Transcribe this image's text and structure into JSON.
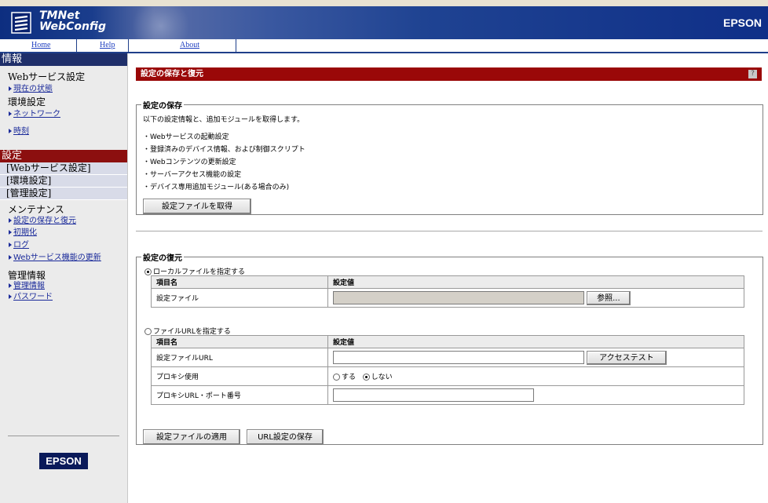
{
  "header": {
    "app_title_line1": "TMNet",
    "app_title_line2": "WebConfig",
    "brand": "EPSON"
  },
  "nav": {
    "home": "Home",
    "help": "Help",
    "about": "About"
  },
  "sidebar": {
    "info_heading": "情報",
    "info_groups": [
      {
        "category": "Webサービス設定",
        "links": [
          "現在の状態"
        ]
      },
      {
        "category": "環境設定",
        "links": [
          "ネットワーク",
          "時刻"
        ]
      }
    ],
    "settings_heading": "設定",
    "bands": [
      "[Webサービス設定]",
      "[環境設定]",
      "[管理設定]"
    ],
    "maint_category": "メンテナンス",
    "maint_links": [
      "設定の保存と復元",
      "初期化",
      "ログ",
      "Webサービス機能の更新"
    ],
    "mgmt_category": "管理情報",
    "mgmt_links": [
      "管理情報",
      "パスワード"
    ],
    "logo": "EPSON"
  },
  "main": {
    "title": "設定の保存と復元",
    "help_icon": "?",
    "save": {
      "legend": "設定の保存",
      "intro": "以下の設定情報と、追加モジュールを取得します。",
      "items": [
        "・Webサービスの起動設定",
        "・登録済みのデバイス情報、および制御スクリプト",
        "・Webコンテンツの更新設定",
        "・サーバーアクセス機能の設定",
        "・デバイス専用追加モジュール(ある場合のみ)"
      ],
      "button": "設定ファイルを取得"
    },
    "restore": {
      "legend": "設定の復元",
      "local_option": "ローカルファイルを指定する",
      "local_table": {
        "col1": "項目名",
        "col2": "設定値",
        "row_label": "設定ファイル",
        "browse_button": "参照..."
      },
      "url_option": "ファイルURLを指定する",
      "url_table": {
        "col1": "項目名",
        "col2": "設定値",
        "row1_label": "設定ファイルURL",
        "access_test_button": "アクセステスト",
        "row2_label": "プロキシ使用",
        "proxy_yes": "する",
        "proxy_no": "しない",
        "row3_label": "プロキシURL・ポート番号"
      },
      "apply_button": "設定ファイルの適用",
      "save_url_button": "URL設定の保存"
    }
  }
}
